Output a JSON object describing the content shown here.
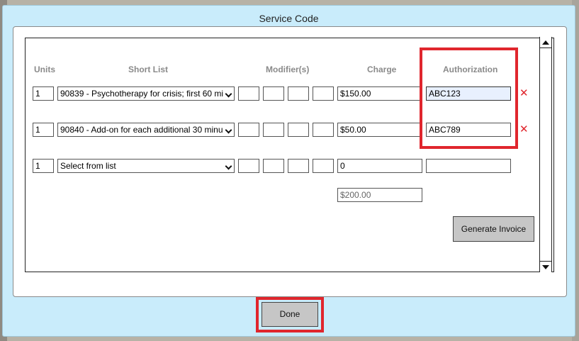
{
  "dialog": {
    "title": "Service Code",
    "done_label": "Done"
  },
  "table": {
    "headers": {
      "units": "Units",
      "short_list": "Short List",
      "modifiers": "Modifier(s)",
      "charge": "Charge",
      "authorization": "Authorization"
    },
    "rows": [
      {
        "units": "1",
        "service": "90839 - Psychotherapy for crisis; first 60 mi",
        "mod1": "",
        "mod2": "",
        "mod3": "",
        "mod4": "",
        "charge": "$150.00",
        "authorization": "ABC123"
      },
      {
        "units": "1",
        "service": "90840 - Add-on for each additional 30 minu",
        "mod1": "",
        "mod2": "",
        "mod3": "",
        "mod4": "",
        "charge": "$50.00",
        "authorization": "ABC789"
      },
      {
        "units": "1",
        "service": "Select from list",
        "mod1": "",
        "mod2": "",
        "mod3": "",
        "mod4": "",
        "charge": "0",
        "authorization": ""
      }
    ],
    "delete_symbol": "✕",
    "total": "$200.00"
  },
  "actions": {
    "generate_invoice_label": "Generate Invoice"
  },
  "colors": {
    "dialog_bg": "#c9ecfb",
    "highlight": "#e0262d",
    "delete_icon": "#e0262d",
    "button_bg": "#c6c6c6"
  }
}
